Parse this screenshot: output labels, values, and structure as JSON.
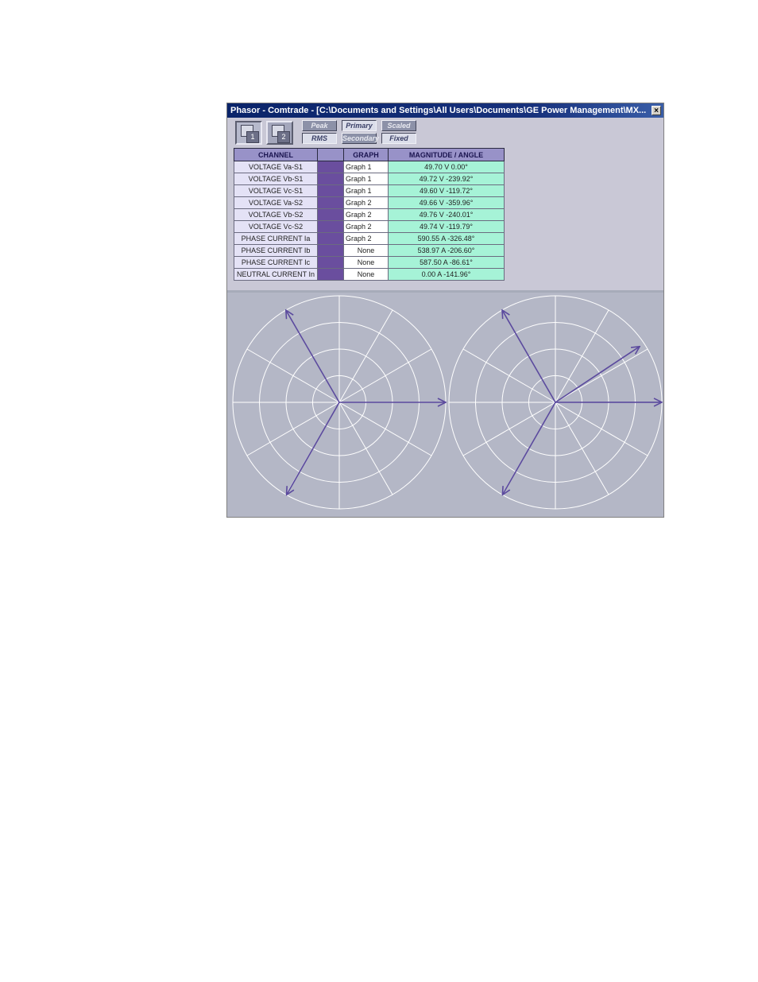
{
  "window": {
    "title": "Phasor - Comtrade - [C:\\Documents and Settings\\All Users\\Documents\\GE Power Management\\MX...",
    "close_label": "×"
  },
  "toolbar": {
    "graph1_label": "1",
    "graph2_label": "2",
    "peak_label": "Peak",
    "rms_label": "RMS",
    "primary_label": "Primary",
    "secondary_label": "Secondary",
    "scaled_label": "Scaled",
    "fixed_label": "Fixed",
    "active_graph": "1",
    "value_mode": "RMS",
    "units_mode": "Primary",
    "scale_mode": "Fixed"
  },
  "table": {
    "headers": [
      "CHANNEL",
      "",
      "GRAPH",
      "MAGNITUDE / ANGLE"
    ],
    "rows": [
      {
        "channel": "VOLTAGE Va-S1",
        "color": "#6a4e9e",
        "graph": "Graph 1",
        "magnitude_angle": "49.70 V  0.00°"
      },
      {
        "channel": "VOLTAGE Vb-S1",
        "color": "#6a4e9e",
        "graph": "Graph 1",
        "magnitude_angle": "49.72 V  -239.92°"
      },
      {
        "channel": "VOLTAGE Vc-S1",
        "color": "#6a4e9e",
        "graph": "Graph 1",
        "magnitude_angle": "49.60 V  -119.72°"
      },
      {
        "channel": "VOLTAGE Va-S2",
        "color": "#6a4e9e",
        "graph": "Graph 2",
        "magnitude_angle": "49.66 V  -359.96°"
      },
      {
        "channel": "VOLTAGE Vb-S2",
        "color": "#6a4e9e",
        "graph": "Graph 2",
        "magnitude_angle": "49.76 V  -240.01°"
      },
      {
        "channel": "VOLTAGE Vc-S2",
        "color": "#6a4e9e",
        "graph": "Graph 2",
        "magnitude_angle": "49.74 V  -119.79°"
      },
      {
        "channel": "PHASE CURRENT Ia",
        "color": "#6a4e9e",
        "graph": "Graph 2",
        "magnitude_angle": "590.55 A  -326.48°"
      },
      {
        "channel": "PHASE CURRENT Ib",
        "color": "#6a4e9e",
        "graph": "None",
        "magnitude_angle": "538.97 A  -206.60°"
      },
      {
        "channel": "PHASE CURRENT Ic",
        "color": "#6a4e9e",
        "graph": "None",
        "magnitude_angle": "587.50 A  -86.61°"
      },
      {
        "channel": "NEUTRAL CURRENT In",
        "color": "#6a4e9e",
        "graph": "None",
        "magnitude_angle": "0.00 A  -141.96°"
      }
    ]
  },
  "graphs": [
    {
      "phasors": [
        {
          "channel": "VOLTAGE Va-S1",
          "magnitude": 1.0,
          "angle": 0.0
        },
        {
          "channel": "VOLTAGE Vb-S1",
          "magnitude": 1.0,
          "angle": -239.92
        },
        {
          "channel": "VOLTAGE Vc-S1",
          "magnitude": 1.0,
          "angle": -119.72
        }
      ]
    },
    {
      "phasors": [
        {
          "channel": "VOLTAGE Va-S2",
          "magnitude": 1.0,
          "angle": -359.96
        },
        {
          "channel": "VOLTAGE Vb-S2",
          "magnitude": 1.0,
          "angle": -240.01
        },
        {
          "channel": "VOLTAGE Vc-S2",
          "magnitude": 1.0,
          "angle": -119.79
        },
        {
          "channel": "PHASE CURRENT Ia",
          "magnitude": 0.95,
          "angle": -326.48
        }
      ]
    }
  ],
  "colors": {
    "phasor": "#5b4a9e",
    "grid": "#ffffff",
    "plot_background": "#b4b7c6",
    "header": "#9892c8",
    "channel_cell": "#e4e2f6",
    "magnitude_cell": "#a6f3d7"
  }
}
